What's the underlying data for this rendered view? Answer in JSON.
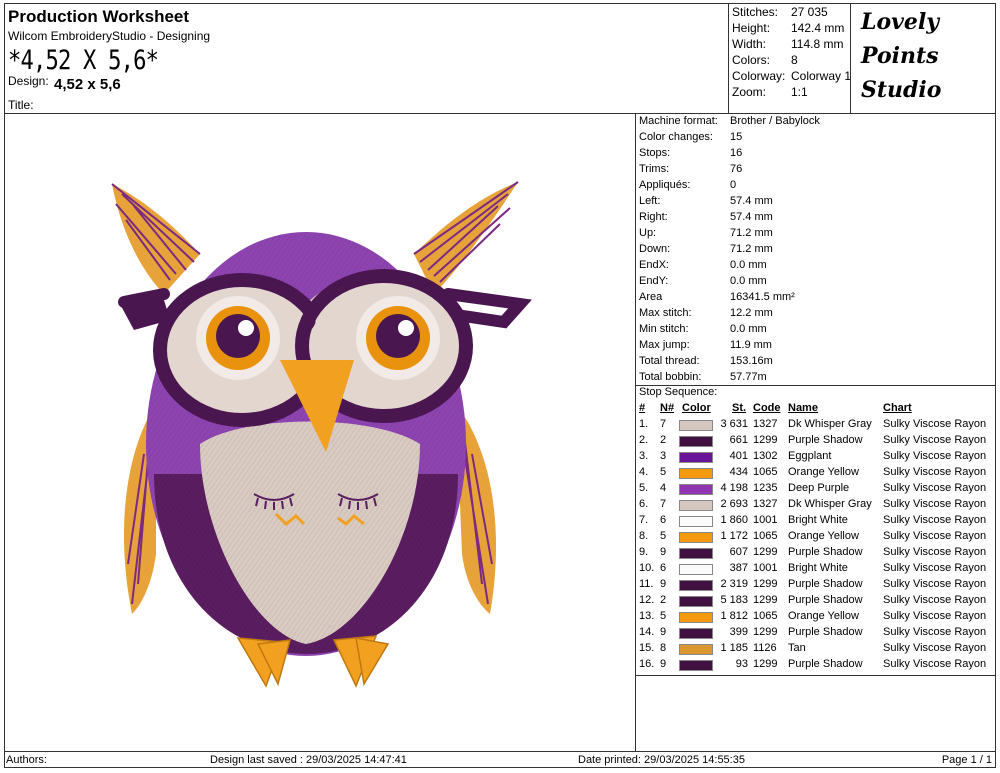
{
  "header": {
    "title": "Production Worksheet",
    "software": "Wilcom EmbroideryStudio - Designing",
    "size_big": "*4,52 X 5,6*",
    "design_label": "Design:",
    "design_value": "4,52 x 5,6",
    "title_label": "Title:"
  },
  "info": [
    {
      "label": "Stitches:",
      "value": "27 035"
    },
    {
      "label": "Height:",
      "value": "142.4 mm"
    },
    {
      "label": "Width:",
      "value": "114.8 mm"
    },
    {
      "label": "Colors:",
      "value": "8"
    },
    {
      "label": "Colorway:",
      "value": "Colorway 1"
    },
    {
      "label": "Zoom:",
      "value": "1:1"
    }
  ],
  "logo": {
    "line1": "Lovely",
    "line2": "Points",
    "line3": "Studio"
  },
  "stats": [
    {
      "label": "Machine format:",
      "value": "Brother / Babylock"
    },
    {
      "label": "Color changes:",
      "value": "15"
    },
    {
      "label": "Stops:",
      "value": "16"
    },
    {
      "label": "Trims:",
      "value": "76"
    },
    {
      "label": "Appliqués:",
      "value": "0"
    },
    {
      "label": "Left:",
      "value": "57.4 mm"
    },
    {
      "label": "Right:",
      "value": "57.4 mm"
    },
    {
      "label": "Up:",
      "value": "71.2 mm"
    },
    {
      "label": "Down:",
      "value": "71.2 mm"
    },
    {
      "label": "EndX:",
      "value": "0.0 mm"
    },
    {
      "label": "EndY:",
      "value": "0.0 mm"
    },
    {
      "label": "Area",
      "value": "16341.5 mm²"
    },
    {
      "label": "Max stitch:",
      "value": "12.2 mm"
    },
    {
      "label": "Min stitch:",
      "value": "0.0 mm"
    },
    {
      "label": "Max jump:",
      "value": "11.9 mm"
    },
    {
      "label": "Total thread:",
      "value": "153.16m"
    },
    {
      "label": "Total bobbin:",
      "value": "57.77m"
    }
  ],
  "sequence": {
    "title": "Stop Sequence:",
    "headers": {
      "idx": "#",
      "n": "N#",
      "color": "Color",
      "st": "St.",
      "code": "Code",
      "name": "Name",
      "chart": "Chart"
    },
    "rows": [
      {
        "idx": "1.",
        "n": "7",
        "color": "#d6c8c0",
        "st": "3 631",
        "code": "1327",
        "name": "Dk Whisper Gray",
        "chart": "Sulky Viscose Rayon"
      },
      {
        "idx": "2.",
        "n": "2",
        "color": "#3f1040",
        "st": "661",
        "code": "1299",
        "name": "Purple Shadow",
        "chart": "Sulky Viscose Rayon"
      },
      {
        "idx": "3.",
        "n": "3",
        "color": "#6a1597",
        "st": "401",
        "code": "1302",
        "name": "Eggplant",
        "chart": "Sulky Viscose Rayon"
      },
      {
        "idx": "4.",
        "n": "5",
        "color": "#f59a10",
        "st": "434",
        "code": "1065",
        "name": "Orange Yellow",
        "chart": "Sulky Viscose Rayon"
      },
      {
        "idx": "5.",
        "n": "4",
        "color": "#8e35b0",
        "st": "4 198",
        "code": "1235",
        "name": "Deep Purple",
        "chart": "Sulky Viscose Rayon"
      },
      {
        "idx": "6.",
        "n": "7",
        "color": "#d6c8c0",
        "st": "2 693",
        "code": "1327",
        "name": "Dk Whisper Gray",
        "chart": "Sulky Viscose Rayon"
      },
      {
        "idx": "7.",
        "n": "6",
        "color": "#fbfbfb",
        "st": "1 860",
        "code": "1001",
        "name": "Bright White",
        "chart": "Sulky Viscose Rayon"
      },
      {
        "idx": "8.",
        "n": "5",
        "color": "#f59a10",
        "st": "1 172",
        "code": "1065",
        "name": "Orange Yellow",
        "chart": "Sulky Viscose Rayon"
      },
      {
        "idx": "9.",
        "n": "9",
        "color": "#3f1040",
        "st": "607",
        "code": "1299",
        "name": "Purple Shadow",
        "chart": "Sulky Viscose Rayon"
      },
      {
        "idx": "10.",
        "n": "6",
        "color": "#fbfbfb",
        "st": "387",
        "code": "1001",
        "name": "Bright White",
        "chart": "Sulky Viscose Rayon"
      },
      {
        "idx": "11.",
        "n": "9",
        "color": "#3f1040",
        "st": "2 319",
        "code": "1299",
        "name": "Purple Shadow",
        "chart": "Sulky Viscose Rayon"
      },
      {
        "idx": "12.",
        "n": "2",
        "color": "#3f1040",
        "st": "5 183",
        "code": "1299",
        "name": "Purple Shadow",
        "chart": "Sulky Viscose Rayon"
      },
      {
        "idx": "13.",
        "n": "5",
        "color": "#f59a10",
        "st": "1 812",
        "code": "1065",
        "name": "Orange Yellow",
        "chart": "Sulky Viscose Rayon"
      },
      {
        "idx": "14.",
        "n": "9",
        "color": "#3f1040",
        "st": "399",
        "code": "1299",
        "name": "Purple Shadow",
        "chart": "Sulky Viscose Rayon"
      },
      {
        "idx": "15.",
        "n": "8",
        "color": "#dc9830",
        "st": "1 185",
        "code": "1126",
        "name": "Tan",
        "chart": "Sulky Viscose Rayon"
      },
      {
        "idx": "16.",
        "n": "9",
        "color": "#3f1040",
        "st": "93",
        "code": "1299",
        "name": "Purple Shadow",
        "chart": "Sulky Viscose Rayon"
      }
    ]
  },
  "footer": {
    "authors": "Authors:",
    "saved": "Design last saved : 29/03/2025 14:47:41",
    "printed": "Date printed: 29/03/2025 14:55:35",
    "page": "Page 1 / 1"
  }
}
